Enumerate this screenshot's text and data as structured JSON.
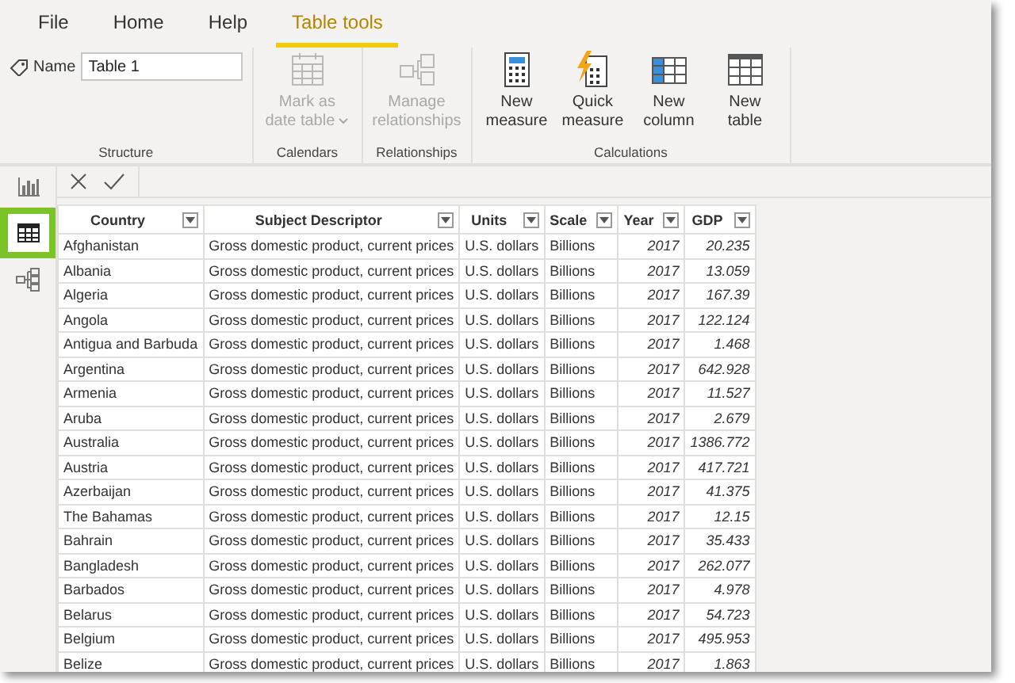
{
  "tabs": [
    {
      "label": "File",
      "selected": false
    },
    {
      "label": "Home",
      "selected": false
    },
    {
      "label": "Help",
      "selected": false
    },
    {
      "label": "Table tools",
      "selected": true
    }
  ],
  "ribbon": {
    "name_field": {
      "label": "Name",
      "value": "Table 1"
    },
    "groups": [
      {
        "title": "Structure",
        "kind": "name"
      },
      {
        "title": "Calendars",
        "kind": "buttons",
        "buttons": [
          {
            "label": "Mark as date table",
            "kind": "calendar",
            "disabled": true,
            "dropdown": true
          }
        ]
      },
      {
        "title": "Relationships",
        "kind": "buttons",
        "buttons": [
          {
            "label": "Manage relationships",
            "kind": "relationships",
            "disabled": true,
            "dropdown": false
          }
        ]
      },
      {
        "title": "Calculations",
        "kind": "buttons",
        "buttons": [
          {
            "label": "New measure",
            "kind": "calculator",
            "disabled": false,
            "dropdown": false
          },
          {
            "label": "Quick measure",
            "kind": "quick",
            "disabled": false,
            "dropdown": false
          },
          {
            "label": "New column",
            "kind": "column",
            "disabled": false,
            "dropdown": false
          },
          {
            "label": "New table",
            "kind": "table",
            "disabled": false,
            "dropdown": false
          }
        ]
      }
    ]
  },
  "sidebar": [
    {
      "kind": "report",
      "selected": false
    },
    {
      "kind": "data",
      "selected": true
    },
    {
      "kind": "model",
      "selected": false
    }
  ],
  "table": {
    "columns": [
      {
        "label": "Country",
        "kind": "text"
      },
      {
        "label": "Subject Descriptor",
        "kind": "text"
      },
      {
        "label": "Units",
        "kind": "text"
      },
      {
        "label": "Scale",
        "kind": "text"
      },
      {
        "label": "Year",
        "kind": "number"
      },
      {
        "label": "GDP",
        "kind": "number"
      }
    ],
    "rows": [
      [
        "Afghanistan",
        "Gross domestic product, current prices",
        "U.S. dollars",
        "Billions",
        "2017",
        "20.235"
      ],
      [
        "Albania",
        "Gross domestic product, current prices",
        "U.S. dollars",
        "Billions",
        "2017",
        "13.059"
      ],
      [
        "Algeria",
        "Gross domestic product, current prices",
        "U.S. dollars",
        "Billions",
        "2017",
        "167.39"
      ],
      [
        "Angola",
        "Gross domestic product, current prices",
        "U.S. dollars",
        "Billions",
        "2017",
        "122.124"
      ],
      [
        "Antigua and Barbuda",
        "Gross domestic product, current prices",
        "U.S. dollars",
        "Billions",
        "2017",
        "1.468"
      ],
      [
        "Argentina",
        "Gross domestic product, current prices",
        "U.S. dollars",
        "Billions",
        "2017",
        "642.928"
      ],
      [
        "Armenia",
        "Gross domestic product, current prices",
        "U.S. dollars",
        "Billions",
        "2017",
        "11.527"
      ],
      [
        "Aruba",
        "Gross domestic product, current prices",
        "U.S. dollars",
        "Billions",
        "2017",
        "2.679"
      ],
      [
        "Australia",
        "Gross domestic product, current prices",
        "U.S. dollars",
        "Billions",
        "2017",
        "1386.772"
      ],
      [
        "Austria",
        "Gross domestic product, current prices",
        "U.S. dollars",
        "Billions",
        "2017",
        "417.721"
      ],
      [
        "Azerbaijan",
        "Gross domestic product, current prices",
        "U.S. dollars",
        "Billions",
        "2017",
        "41.375"
      ],
      [
        "The Bahamas",
        "Gross domestic product, current prices",
        "U.S. dollars",
        "Billions",
        "2017",
        "12.15"
      ],
      [
        "Bahrain",
        "Gross domestic product, current prices",
        "U.S. dollars",
        "Billions",
        "2017",
        "35.433"
      ],
      [
        "Bangladesh",
        "Gross domestic product, current prices",
        "U.S. dollars",
        "Billions",
        "2017",
        "262.077"
      ],
      [
        "Barbados",
        "Gross domestic product, current prices",
        "U.S. dollars",
        "Billions",
        "2017",
        "4.978"
      ],
      [
        "Belarus",
        "Gross domestic product, current prices",
        "U.S. dollars",
        "Billions",
        "2017",
        "54.723"
      ],
      [
        "Belgium",
        "Gross domestic product, current prices",
        "U.S. dollars",
        "Billions",
        "2017",
        "495.953"
      ],
      [
        "Belize",
        "Gross domestic product, current prices",
        "U.S. dollars",
        "Billions",
        "2017",
        "1.863"
      ]
    ]
  }
}
